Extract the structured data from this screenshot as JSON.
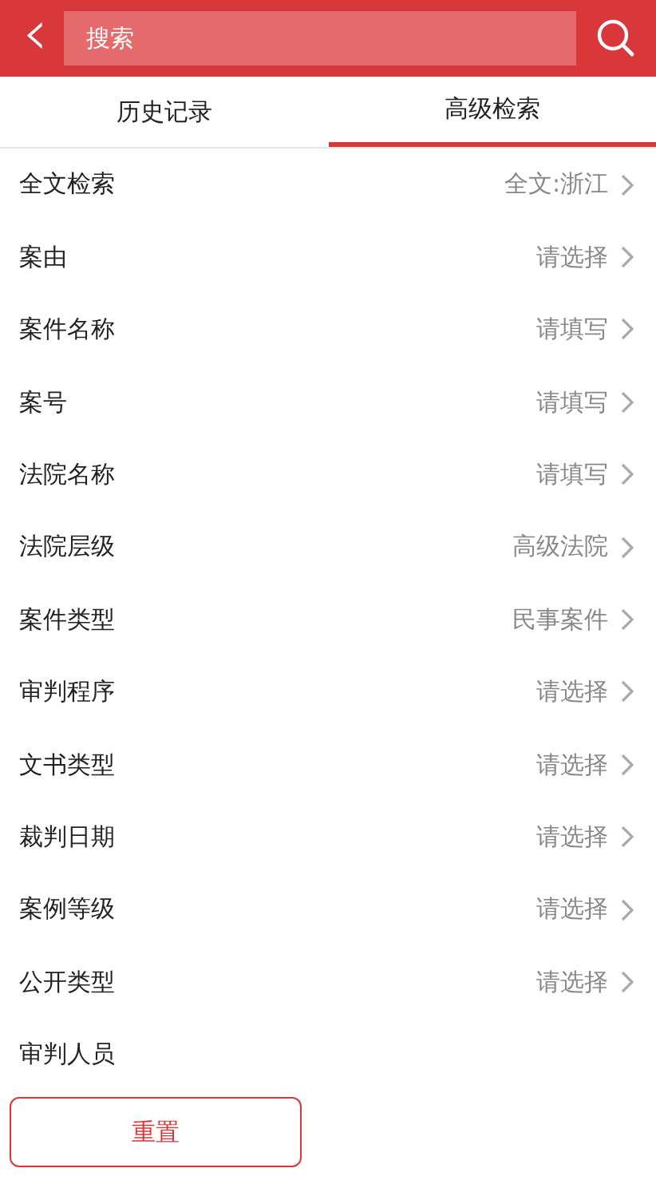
{
  "header": {
    "back": "‹",
    "search": {
      "placeholder": "搜索"
    }
  },
  "tabs": [
    {
      "label": "历史记录",
      "selected": false
    },
    {
      "label": "高级检索",
      "selected": true
    }
  ],
  "fields": [
    {
      "label": "全文检索",
      "value": "全文:浙江"
    },
    {
      "label": "案由",
      "value": "请选择"
    },
    {
      "label": "案件名称",
      "value": "请填写"
    },
    {
      "label": "案号",
      "value": "请填写"
    },
    {
      "label": "法院名称",
      "value": "请填写"
    },
    {
      "label": "法院层级",
      "value": "高级法院"
    },
    {
      "label": "案件类型",
      "value": "民事案件"
    },
    {
      "label": "审判程序",
      "value": "请选择"
    },
    {
      "label": "文书类型",
      "value": "请选择"
    },
    {
      "label": "裁判日期",
      "value": "请选择"
    },
    {
      "label": "案例等级",
      "value": "请选择"
    },
    {
      "label": "公开类型",
      "value": "请选择"
    },
    {
      "label": "审判人员"
    }
  ],
  "buttons": [
    {
      "label": "重置"
    }
  ]
}
